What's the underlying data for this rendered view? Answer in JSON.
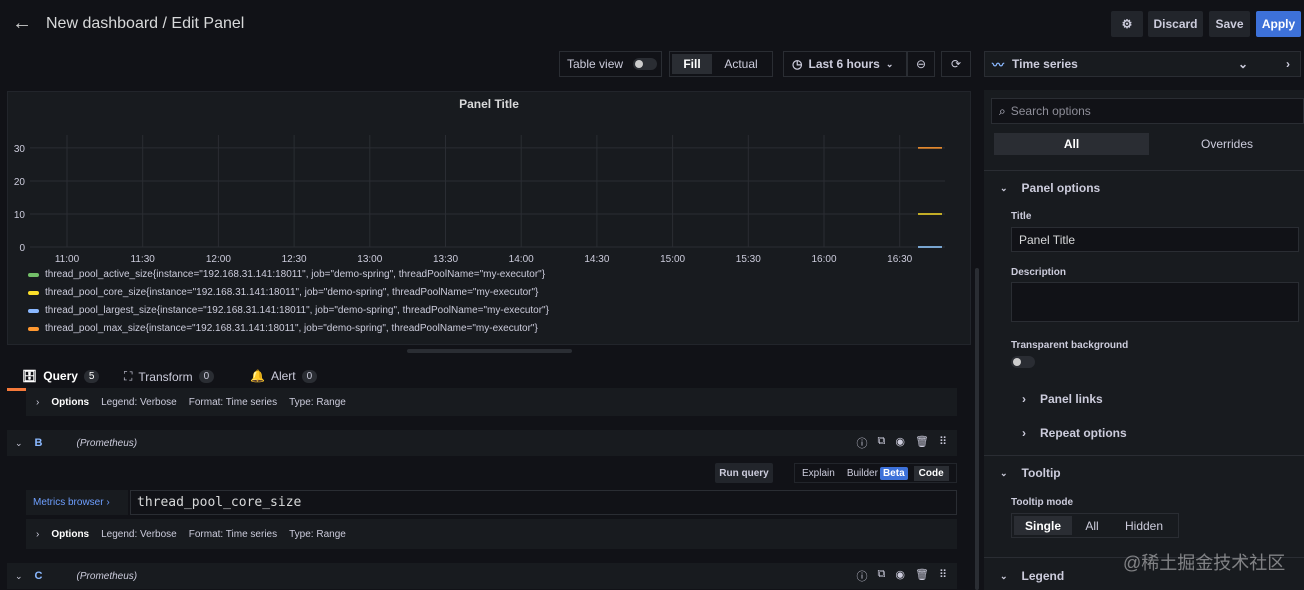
{
  "header": {
    "title": "New dashboard / Edit Panel",
    "discard": "Discard",
    "save": "Save",
    "apply": "Apply"
  },
  "toolbar": {
    "table_view": "Table view",
    "fill": "Fill",
    "actual": "Actual",
    "time_range": "Last 6 hours",
    "viz": "Time series"
  },
  "chart_data": {
    "type": "line",
    "title": "Panel Title",
    "x_ticks": [
      "11:00",
      "11:30",
      "12:00",
      "12:30",
      "13:00",
      "13:30",
      "14:00",
      "14:30",
      "15:00",
      "15:30",
      "16:00",
      "16:30"
    ],
    "y_ticks": [
      0,
      10,
      20,
      30
    ],
    "ylim": [
      0,
      33
    ],
    "grid": true,
    "legend_placement": "bottom",
    "series": [
      {
        "name": "thread_pool_active_size{instance=\"192.168.31.141:18011\", job=\"demo-spring\", threadPoolName=\"my-executor\"}",
        "color": "#73bf69",
        "value": 0
      },
      {
        "name": "thread_pool_core_size{instance=\"192.168.31.141:18011\", job=\"demo-spring\", threadPoolName=\"my-executor\"}",
        "color": "#fade2a",
        "value": 10
      },
      {
        "name": "thread_pool_largest_size{instance=\"192.168.31.141:18011\", job=\"demo-spring\", threadPoolName=\"my-executor\"}",
        "color": "#8ab8ff",
        "value": 0
      },
      {
        "name": "thread_pool_max_size{instance=\"192.168.31.141:18011\", job=\"demo-spring\", threadPoolName=\"my-executor\"}",
        "color": "#ff9830",
        "value": 30
      }
    ]
  },
  "tabs": [
    {
      "label": "Query",
      "count": "5"
    },
    {
      "label": "Transform",
      "count": "0"
    },
    {
      "label": "Alert",
      "count": "0"
    }
  ],
  "queries": {
    "options": "Options",
    "legend": "Legend: Verbose",
    "format": "Format: Time series",
    "type": "Range",
    "b": {
      "letter": "B",
      "ds": "(Prometheus)"
    },
    "c": {
      "letter": "C",
      "ds": "(Prometheus)"
    },
    "run_query": "Run query",
    "explain": "Explain",
    "builder": "Builder",
    "beta": "Beta",
    "code": "Code",
    "metrics_browser": "Metrics browser",
    "expr": "thread_pool_core_size",
    "type_label": "Type: Range"
  },
  "options": {
    "search_placeholder": "Search options",
    "all": "All",
    "overrides": "Overrides",
    "panel_options": "Panel options",
    "title_label": "Title",
    "title_value": "Panel Title",
    "description": "Description",
    "transparent": "Transparent background",
    "panel_links": "Panel links",
    "repeat": "Repeat options",
    "tooltip": "Tooltip",
    "tooltip_mode": "Tooltip mode",
    "single": "Single",
    "all_mode": "All",
    "hidden": "Hidden",
    "legend": "Legend"
  },
  "watermark": "@稀土掘金技术社区"
}
